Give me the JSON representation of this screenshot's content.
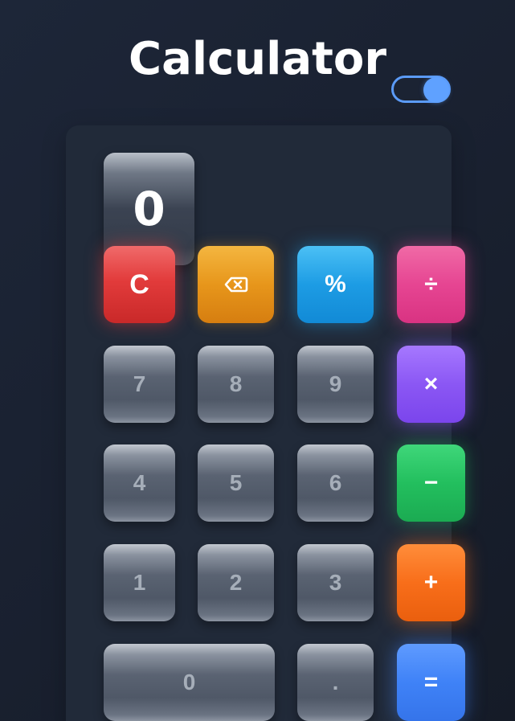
{
  "app": {
    "title": "Calculator",
    "theme_toggle": {
      "state": "on"
    }
  },
  "display": {
    "value": "0"
  },
  "keypad": {
    "clear": "C",
    "backspace": "backspace-icon",
    "percent": "%",
    "divide": "÷",
    "multiply": "×",
    "subtract": "−",
    "add": "+",
    "equals": "=",
    "digits": {
      "d7": "7",
      "d8": "8",
      "d9": "9",
      "d4": "4",
      "d5": "5",
      "d6": "6",
      "d1": "1",
      "d2": "2",
      "d3": "3",
      "d0": "0",
      "dot": "."
    }
  },
  "colors": {
    "background": "#1a2130",
    "panel": "#212a39",
    "toggle_accent": "#5b9bf8",
    "clear": "#e23b3b",
    "backspace": "#e7961b",
    "percent": "#1d9ce4",
    "divide": "#e64592",
    "multiply": "#8b57f4",
    "subtract": "#23bf5e",
    "add": "#f86e1a",
    "equals": "#3f82f7"
  }
}
